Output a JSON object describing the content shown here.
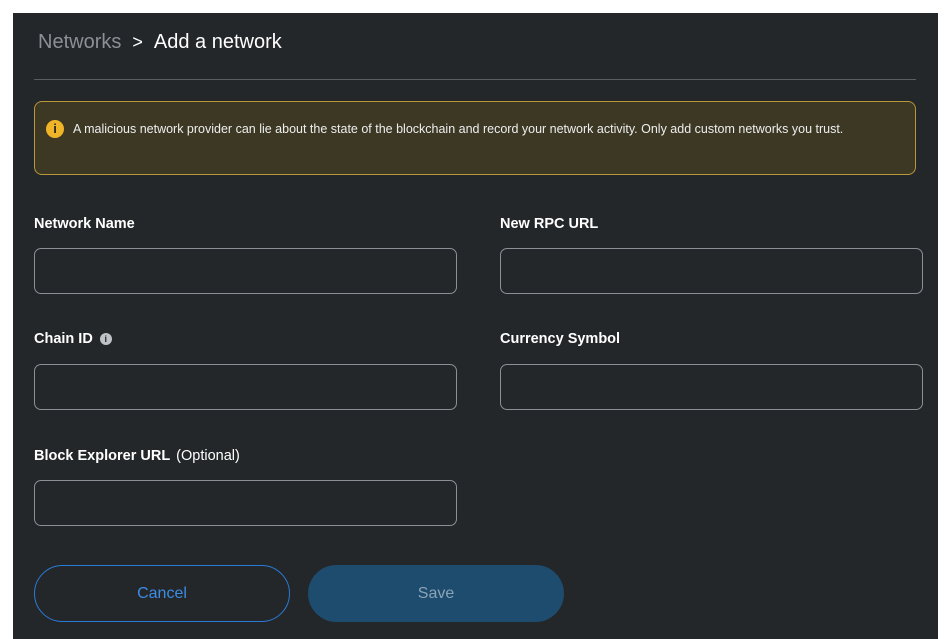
{
  "breadcrumb": {
    "parent": "Networks",
    "separator": ">",
    "current": "Add a network"
  },
  "warning": {
    "icon": "info-circle-icon",
    "text": "A malicious network provider can lie about the state of the blockchain and record your network activity. Only add custom networks you trust."
  },
  "form": {
    "network_name": {
      "label": "Network Name",
      "value": ""
    },
    "rpc_url": {
      "label": "New RPC URL",
      "value": ""
    },
    "chain_id": {
      "label": "Chain ID",
      "value": "",
      "icon": "info-icon"
    },
    "currency_symbol": {
      "label": "Currency Symbol",
      "value": ""
    },
    "block_explorer": {
      "label": "Block Explorer URL",
      "optional": "(Optional)",
      "value": ""
    }
  },
  "actions": {
    "cancel_label": "Cancel",
    "save_label": "Save"
  },
  "colors": {
    "background": "#24272a",
    "warning_border": "#b9973a",
    "warning_bg": "#3c3824",
    "primary": "#2a7bd6",
    "save_disabled": "#1d4c6f"
  }
}
